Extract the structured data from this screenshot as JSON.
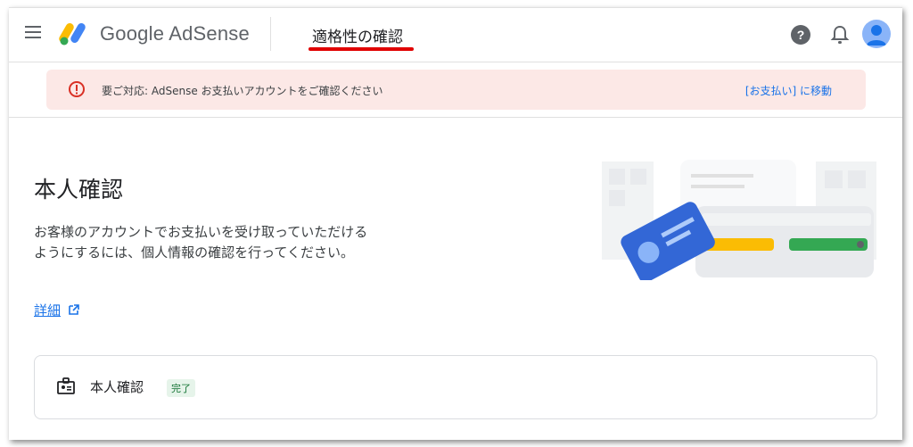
{
  "header": {
    "brand": "Google AdSense",
    "page_title": "適格性の確認",
    "help_icon": "help-icon",
    "notifications_icon": "bell-icon",
    "avatar_icon": "account-avatar"
  },
  "alert": {
    "icon": "error-icon",
    "message": "要ご対応: AdSense お支払いアカウントをご確認ください",
    "link_label": "[お支払い] に移動",
    "color": "#fce8e6"
  },
  "main": {
    "heading": "本人確認",
    "description": "お客様のアカウントでお支払いを受け取っていただけるようにするには、個人情報の確認を行ってください。",
    "learn_more": "詳細"
  },
  "card": {
    "icon": "id-badge-icon",
    "label": "本人確認",
    "status": "完了"
  },
  "colors": {
    "link": "#1a73e8",
    "annotation_underline": "#e00000",
    "badge_bg": "#e6f4ea",
    "badge_text": "#137333"
  }
}
